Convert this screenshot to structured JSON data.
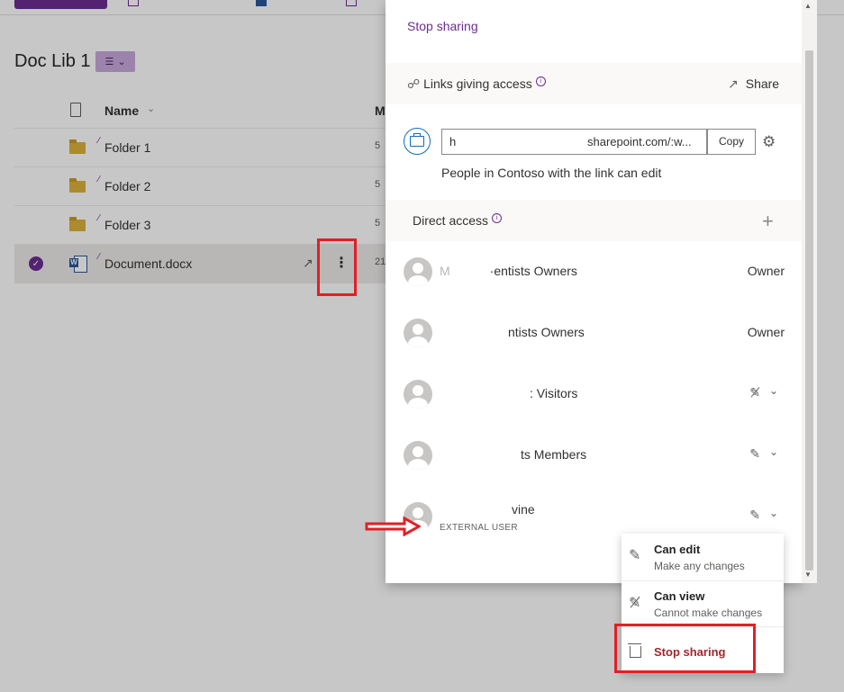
{
  "library": {
    "title": "Doc Lib 1",
    "view_icon": "library-view-icon",
    "columns": {
      "name": "Name",
      "modified": "M"
    },
    "rows": [
      {
        "name": "Folder 1",
        "modified": "5",
        "type": "folder"
      },
      {
        "name": "Folder 2",
        "modified": "5",
        "type": "folder"
      },
      {
        "name": "Folder 3",
        "modified": "5",
        "type": "folder"
      },
      {
        "name": "Document.docx",
        "modified": "21",
        "type": "word",
        "selected": true
      }
    ]
  },
  "panel": {
    "stop_sharing_link": "Stop sharing",
    "links_section": {
      "title": "Links giving access",
      "share_label": "Share"
    },
    "link": {
      "url_prefix": "h",
      "url": "sharepoint.com/:w...",
      "copy_label": "Copy",
      "description": "People in Contoso with the link can edit"
    },
    "direct_access": {
      "title": "Direct access"
    },
    "people": [
      {
        "name_left": "M",
        "name": "·entists Owners",
        "role": "Owner"
      },
      {
        "name": "ntists Owners",
        "role": "Owner"
      },
      {
        "name": ": Visitors",
        "role": ""
      },
      {
        "name": "ts Members",
        "role": ""
      },
      {
        "name": "vine",
        "sub": "EXTERNAL USER",
        "role": ""
      }
    ]
  },
  "menu": {
    "can_edit": {
      "label": "Can edit",
      "sub": "Make any changes"
    },
    "can_view": {
      "label": "Can view",
      "sub": "Cannot make changes"
    },
    "stop_sharing": "Stop sharing"
  },
  "colors": {
    "brand": "#6b2c91",
    "danger": "#a4262c",
    "annotation_red": "#e21f26"
  }
}
